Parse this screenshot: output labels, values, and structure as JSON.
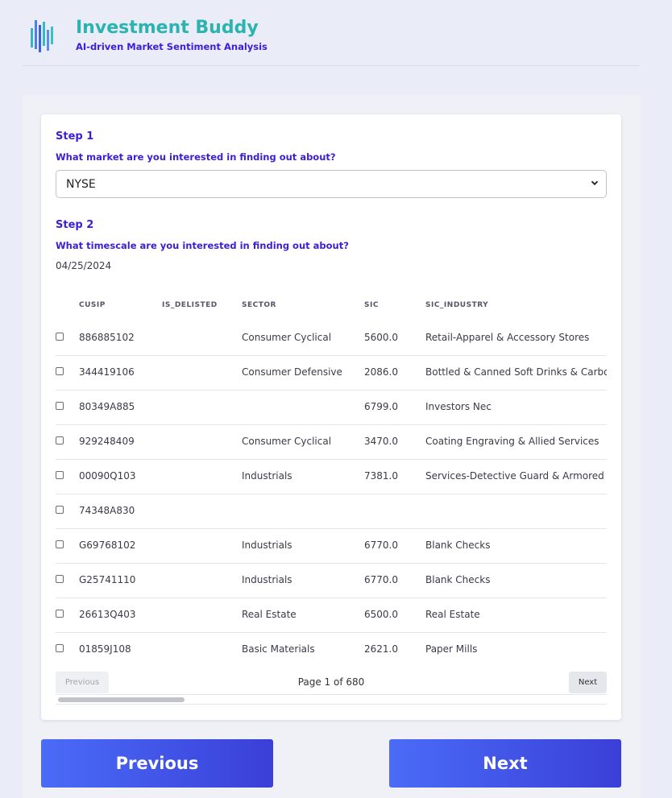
{
  "app": {
    "title": "Investment Buddy",
    "subtitle": "AI-driven Market Sentiment Analysis",
    "logo": "bar-chart-logo"
  },
  "colors": {
    "brand_teal": "#2bb3b0",
    "accent_purple": "#3b1fd6",
    "button_blue": "#4a6cf7",
    "background": "#eaedf7"
  },
  "step1": {
    "title": "Step 1",
    "question": "What market are you interested in finding out about?",
    "selected_market": "NYSE"
  },
  "step2": {
    "title": "Step 2",
    "question": "What timescale are you interested in finding out about?",
    "date": "04/25/2024"
  },
  "table": {
    "headers": [
      "CUSIP",
      "IS_DELISTED",
      "SECTOR",
      "SIC",
      "SIC_INDUSTRY"
    ],
    "rows": [
      {
        "cusip": "886885102",
        "is_delisted": "",
        "sector": "Consumer Cyclical",
        "sic": "5600.0",
        "sic_industry": "Retail-Apparel & Accessory Stores"
      },
      {
        "cusip": "344419106",
        "is_delisted": "",
        "sector": "Consumer Defensive",
        "sic": "2086.0",
        "sic_industry": "Bottled & Canned Soft Drinks & Carbonat"
      },
      {
        "cusip": "80349A885",
        "is_delisted": "",
        "sector": "",
        "sic": "6799.0",
        "sic_industry": "Investors Nec"
      },
      {
        "cusip": "929248409",
        "is_delisted": "",
        "sector": "Consumer Cyclical",
        "sic": "3470.0",
        "sic_industry": "Coating Engraving & Allied Services"
      },
      {
        "cusip": "00090Q103",
        "is_delisted": "",
        "sector": "Industrials",
        "sic": "7381.0",
        "sic_industry": "Services-Detective Guard & Armored Car"
      },
      {
        "cusip": "74348A830",
        "is_delisted": "",
        "sector": "",
        "sic": "",
        "sic_industry": ""
      },
      {
        "cusip": "G69768102",
        "is_delisted": "",
        "sector": "Industrials",
        "sic": "6770.0",
        "sic_industry": "Blank Checks"
      },
      {
        "cusip": "G25741110",
        "is_delisted": "",
        "sector": "Industrials",
        "sic": "6770.0",
        "sic_industry": "Blank Checks"
      },
      {
        "cusip": "26613Q403",
        "is_delisted": "",
        "sector": "Real Estate",
        "sic": "6500.0",
        "sic_industry": "Real Estate"
      },
      {
        "cusip": "01859J108",
        "is_delisted": "",
        "sector": "Basic Materials",
        "sic": "2621.0",
        "sic_industry": "Paper Mills"
      }
    ]
  },
  "pager": {
    "previous_label": "Previous",
    "next_label": "Next",
    "page_info": "Page 1 of 680"
  },
  "nav": {
    "previous_label": "Previous",
    "next_label": "Next"
  }
}
